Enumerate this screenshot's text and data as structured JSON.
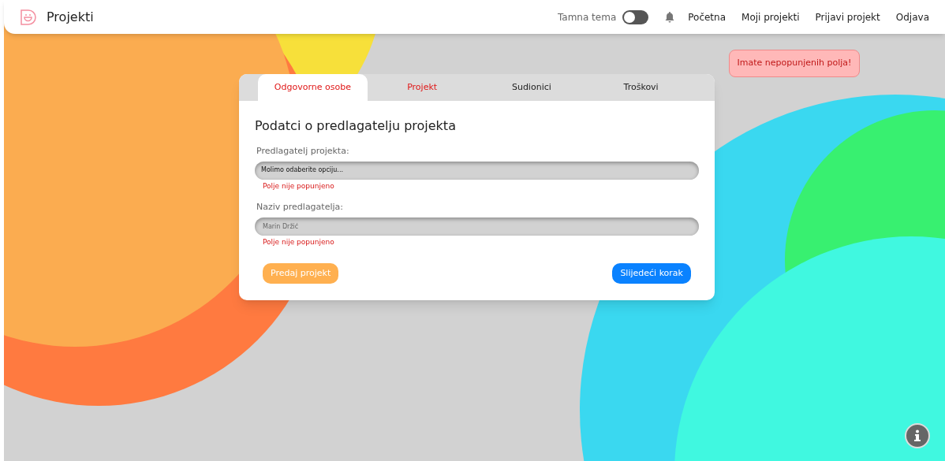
{
  "header": {
    "title": "Projekti",
    "theme_toggle": {
      "label": "Tamna tema",
      "on": false
    },
    "nav": [
      "Početna",
      "Moji projekti",
      "Prijavi projekt",
      "Odjava"
    ]
  },
  "toast": {
    "message": "Imate nepopunjenih polja!"
  },
  "tabs": [
    {
      "label": "Odgovorne osobe",
      "selected": true,
      "error": true
    },
    {
      "label": "Projekt",
      "selected": false,
      "error": true
    },
    {
      "label": "Sudionici",
      "selected": false,
      "error": false
    },
    {
      "label": "Troškovi",
      "selected": false,
      "error": false
    }
  ],
  "form": {
    "heading": "Podatci o predlagatelju projekta",
    "fields": [
      {
        "kind": "select",
        "label": "Predlagatelj projekta:",
        "placeholder": "Molimo odaberite opciju...",
        "error": "Polje nije popunjeno"
      },
      {
        "kind": "input",
        "label": "Naziv predlagatelja:",
        "placeholder": "Marin Držić",
        "error": "Polje nije popunjeno"
      }
    ],
    "buttons": [
      {
        "label": "Predaj projekt",
        "kind": "submit"
      },
      {
        "label": "Slijedeći korak",
        "kind": "next"
      }
    ]
  }
}
